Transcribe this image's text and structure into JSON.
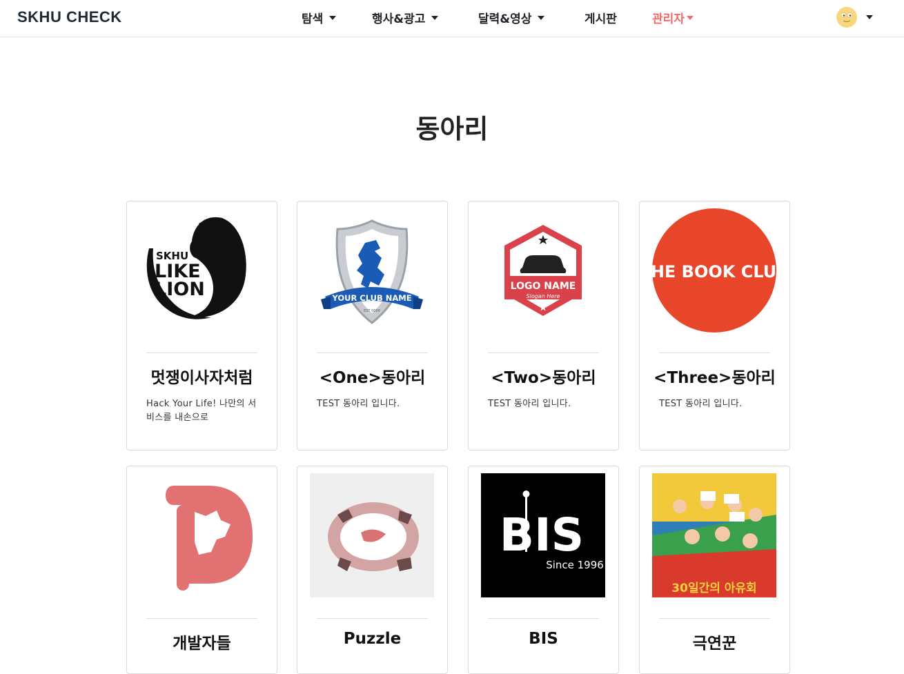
{
  "brand": "SKHU CHECK",
  "nav": {
    "explore": "탐색",
    "events": "행사&광고",
    "calendar": "달력&영상",
    "board": "게시판",
    "admin": "관리자"
  },
  "colors": {
    "accent": "#f06a6a",
    "border": "#dcdcdc",
    "text": "#212529"
  },
  "page_title": "동아리",
  "clubs": [
    {
      "name": "멋쟁이사자처럼",
      "description": "Hack Your Life! 나만의 서비스를 내손으로",
      "logo": "likelion-logo",
      "logo_line1": "SKHU",
      "logo_line2": "LIKE",
      "logo_line3": "LION"
    },
    {
      "name": "<One>동아리",
      "description": "TEST 동아리 입니다.",
      "logo": "shield-lion-logo",
      "logo_text": "YOUR CLUB NAME",
      "logo_small": "EST 0000"
    },
    {
      "name": "<Two>동아리",
      "description": "TEST 동아리 입니다.",
      "logo": "car-hexagon-logo",
      "logo_text": "LOGO NAME",
      "logo_slogan": "Slogan Here"
    },
    {
      "name": "<Three>동아리",
      "description": "TEST 동아리 입니다.",
      "logo": "book-club-logo",
      "logo_text": "THE BOOK CLUB"
    },
    {
      "name": "개발자들",
      "description": "",
      "logo": "dev-d-logo"
    },
    {
      "name": "Puzzle",
      "description": "",
      "logo": "puzzle-logo"
    },
    {
      "name": "BIS",
      "description": "",
      "logo": "bis-logo",
      "logo_text": "BIS",
      "logo_since": "Since 1996"
    },
    {
      "name": "극연꾼",
      "description": "",
      "logo": "poster-image",
      "logo_text": "30일간의 아유회"
    }
  ]
}
